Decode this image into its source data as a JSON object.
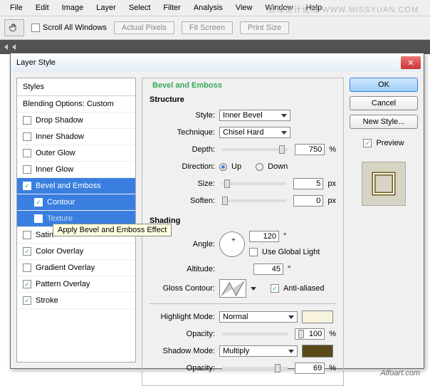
{
  "menubar": [
    "File",
    "Edit",
    "Image",
    "Layer",
    "Select",
    "Filter",
    "Analysis",
    "View",
    "Window",
    "Help"
  ],
  "watermark": "思缘设计论坛 WWW.MISSYUAN.COM",
  "toolbar": {
    "scroll_all": "Scroll All Windows",
    "btns": [
      "Actual Pixels",
      "Fit Screen",
      "Print Size"
    ]
  },
  "dialog": {
    "title": "Layer Style"
  },
  "styles_header": "Styles",
  "blending_options": "Blending Options: Custom",
  "style_list": {
    "drop_shadow": "Drop Shadow",
    "inner_shadow": "Inner Shadow",
    "outer_glow": "Outer Glow",
    "inner_glow": "Inner Glow",
    "bevel_emboss": "Bevel and Emboss",
    "contour": "Contour",
    "texture": "Texture",
    "satin": "Satin",
    "color_overlay": "Color Overlay",
    "gradient_overlay": "Gradient Overlay",
    "pattern_overlay": "Pattern Overlay",
    "stroke": "Stroke"
  },
  "tooltip": "Apply Bevel and Emboss Effect",
  "bevel": {
    "title": "Bevel and Emboss",
    "structure": "Structure",
    "style_label": "Style:",
    "style_val": "Inner Bevel",
    "technique_label": "Technique:",
    "technique_val": "Chisel Hard",
    "depth_label": "Depth:",
    "depth_val": "750",
    "pct": "%",
    "direction_label": "Direction:",
    "up": "Up",
    "down": "Down",
    "size_label": "Size:",
    "size_val": "5",
    "px": "px",
    "soften_label": "Soften:",
    "soften_val": "0",
    "shading": "Shading",
    "angle_label": "Angle:",
    "angle_val": "120",
    "deg": "°",
    "global_light": "Use Global Light",
    "altitude_label": "Altitude:",
    "altitude_val": "45",
    "gloss_label": "Gloss Contour:",
    "antialiased": "Anti-aliased",
    "highlight_label": "Highlight Mode:",
    "highlight_val": "Normal",
    "opacity_label": "Opacity:",
    "highlight_opacity": "100",
    "shadow_label": "Shadow Mode:",
    "shadow_val": "Multiply",
    "shadow_opacity": "69",
    "colors": {
      "highlight": "#f8f3dd",
      "shadow": "#5a4a1a"
    }
  },
  "buttons": {
    "ok": "OK",
    "cancel": "Cancel",
    "new_style": "New Style...",
    "preview": "Preview"
  },
  "footer": "Alfoart.com"
}
